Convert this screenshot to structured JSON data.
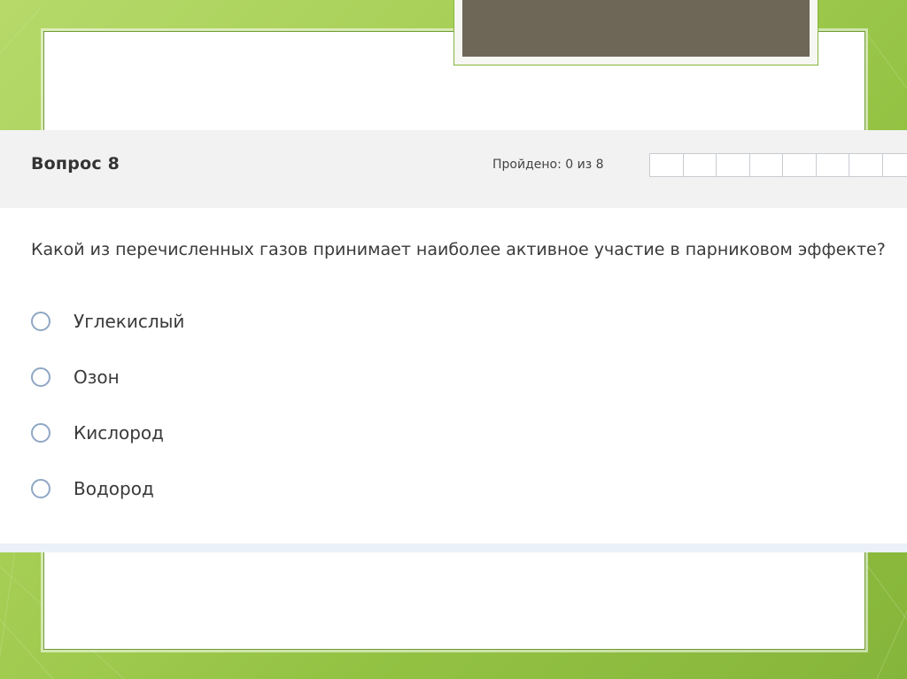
{
  "quiz": {
    "question_number": "Вопрос 8",
    "progress_label": "Пройдено: 0 из 8",
    "progress": {
      "completed": 0,
      "total": 8
    },
    "question_text": "Какой из перечисленных газов принимает наиболее активное участие в парниковом эффекте?",
    "answers": [
      {
        "label": "Углекислый",
        "selected": false
      },
      {
        "label": "Озон",
        "selected": false
      },
      {
        "label": "Кислород",
        "selected": false
      },
      {
        "label": "Водород",
        "selected": false
      }
    ]
  },
  "colors": {
    "background_green": "#9ccb4c",
    "title_plate": "#6e6657",
    "header_bg": "#f2f2f2",
    "radio_border": "#8fa7c4",
    "text": "#3a3a3a"
  },
  "icons": [
    "radio-button-icon"
  ]
}
